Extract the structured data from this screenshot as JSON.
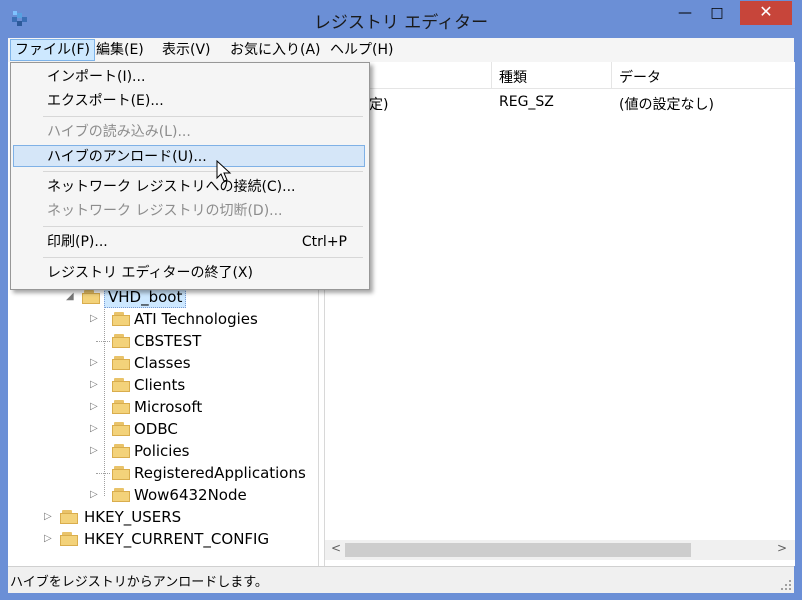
{
  "window": {
    "title": "レジストリ エディター",
    "min_glyph": "—",
    "max_glyph": "□",
    "close_glyph": "✕"
  },
  "menubar": [
    {
      "label": "ファイル(F)"
    },
    {
      "label": "編集(E)"
    },
    {
      "label": "表示(V)"
    },
    {
      "label": "お気に入り(A)"
    },
    {
      "label": "ヘルプ(H)"
    }
  ],
  "file_menu": {
    "items": [
      {
        "label": "インポート(I)...",
        "shortcut": ""
      },
      {
        "label": "エクスポート(E)...",
        "shortcut": ""
      },
      {
        "label": "ハイブの読み込み(L)...",
        "shortcut": ""
      },
      {
        "label": "ハイブのアンロード(U)...",
        "shortcut": ""
      },
      {
        "label": "ネットワーク レジストリへの接続(C)...",
        "shortcut": ""
      },
      {
        "label": "ネットワーク レジストリの切断(D)...",
        "shortcut": ""
      },
      {
        "label": "印刷(P)...",
        "shortcut": "Ctrl+P"
      },
      {
        "label": "レジストリ エディターの終了(X)",
        "shortcut": ""
      }
    ]
  },
  "list": {
    "columns": [
      "種類",
      "データ"
    ],
    "rows": [
      {
        "name_partial": "定)",
        "type": "REG_SZ",
        "data": "(値の設定なし)"
      }
    ]
  },
  "tree": {
    "selected": "VHD_boot",
    "children": [
      "ATI Technologies",
      "CBSTEST",
      "Classes",
      "Clients",
      "Microsoft",
      "ODBC",
      "Policies",
      "RegisteredApplications",
      "Wow6432Node"
    ],
    "roots": [
      "HKEY_USERS",
      "HKEY_CURRENT_CONFIG"
    ]
  },
  "status": {
    "text": "ハイブをレジストリからアンロードします。"
  },
  "glyphs": {
    "expand": "▷",
    "collapse": "◢",
    "left": "<",
    "right": ">"
  }
}
